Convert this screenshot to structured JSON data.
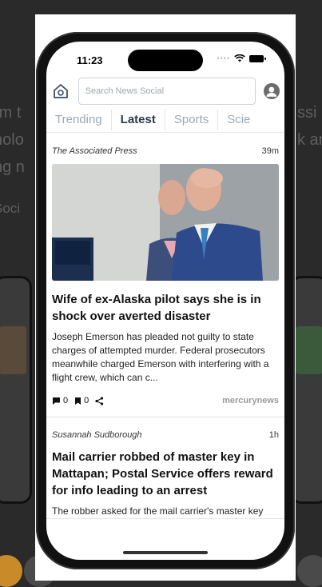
{
  "background": {
    "text_lines": [
      "rm t",
      "nolo",
      "ng n",
      "Soci"
    ],
    "right_text_lines": [
      "ssi",
      "k an"
    ]
  },
  "status_bar": {
    "time": "11:23",
    "signal": "cellular-dots-icon",
    "wifi": "wifi-icon",
    "battery": "battery-icon"
  },
  "header": {
    "home_icon": "home-icon",
    "search_placeholder": "Search News Social",
    "account_icon": "user-avatar-icon"
  },
  "tabs": [
    {
      "label": "Trending",
      "active": false
    },
    {
      "label": "Latest",
      "active": true
    },
    {
      "label": "Sports",
      "active": false
    },
    {
      "label": "Scie",
      "active": false
    }
  ],
  "articles": [
    {
      "source": "The Associated Press",
      "age": "39m",
      "headline": "Wife of ex-Alaska pilot says she is in shock over averted disaster",
      "summary": "Joseph Emerson has pleaded not guilty to state charges of attempted murder. Federal prosecutors meanwhile charged Emerson with interfering with a flight crew, which can c...",
      "comments": "0",
      "bookmarks": "0",
      "publisher": "mercurynews"
    },
    {
      "source": "Susannah Sudborough",
      "age": "1h",
      "headline": "Mail carrier robbed of master key in Mattapan; Postal Service offers reward for info leading to an arrest",
      "summary": "The robber asked for the mail carrier's master key"
    }
  ],
  "colors": {
    "accent": "#2b3a4b",
    "tab_inactive": "#9aa8b8",
    "home_icon": "#3d4f66"
  }
}
